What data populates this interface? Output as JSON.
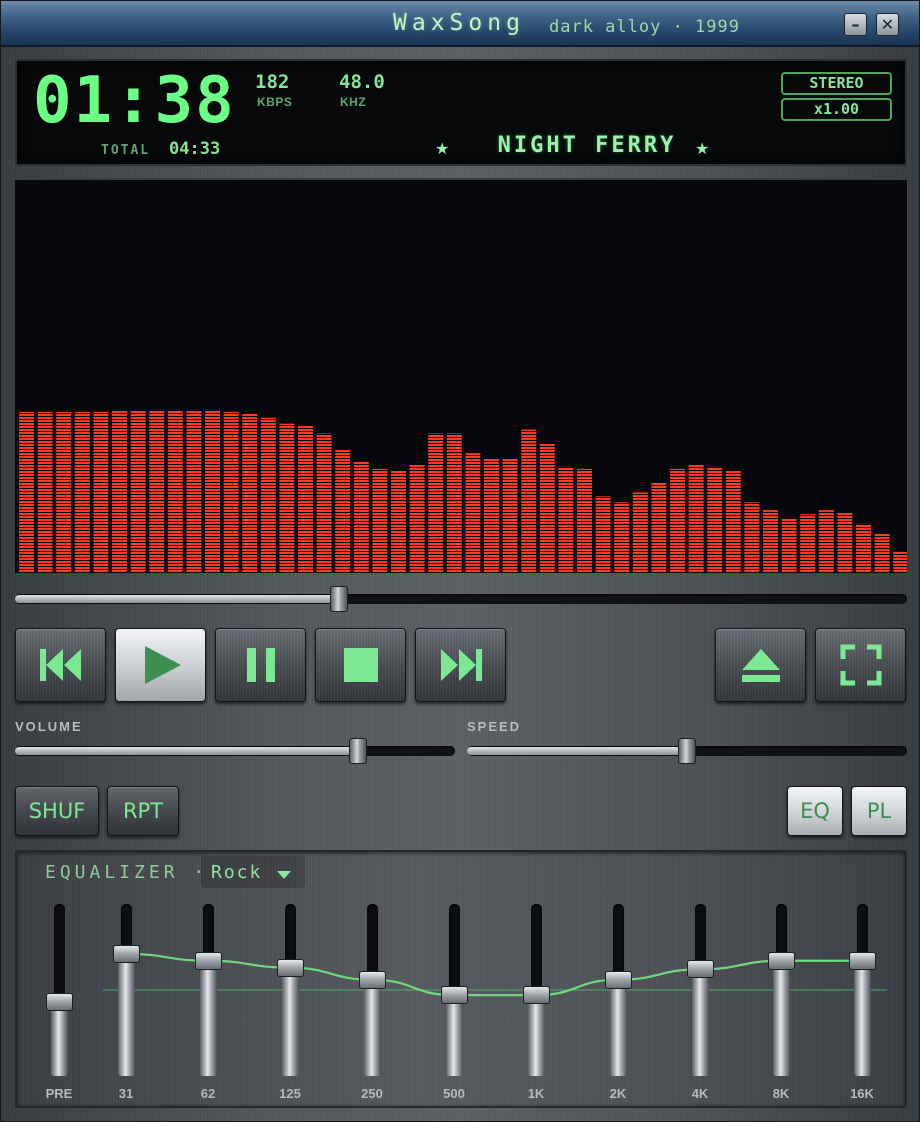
{
  "window": {
    "app_name": "WaxSong",
    "subtitle": "dark alloy · 1999",
    "minimize_glyph": "–",
    "close_glyph": "✕"
  },
  "display": {
    "time": "01:38",
    "bitrate": "182",
    "bitrate_unit": "KBPS",
    "samplerate": "48.0",
    "samplerate_unit": "KHZ",
    "total_label": "TOTAL",
    "total": "04:33",
    "channel_mode": "STEREO",
    "playback_rate": "x1.00",
    "track_title": "NIGHT FERRY",
    "star": "★"
  },
  "visualizer": {
    "levels": [
      0.41,
      0.41,
      0.41,
      0.41,
      0.41,
      0.415,
      0.415,
      0.415,
      0.415,
      0.415,
      0.415,
      0.41,
      0.405,
      0.395,
      0.38,
      0.375,
      0.355,
      0.315,
      0.285,
      0.265,
      0.26,
      0.275,
      0.355,
      0.355,
      0.305,
      0.29,
      0.29,
      0.365,
      0.33,
      0.27,
      0.265,
      0.195,
      0.18,
      0.205,
      0.23,
      0.265,
      0.275,
      0.27,
      0.26,
      0.18,
      0.16,
      0.14,
      0.15,
      0.16,
      0.155,
      0.125,
      0.1,
      0.055,
      0.025
    ],
    "colors": {
      "top": "#ff3a1f",
      "mid": "#f7b72a",
      "bottom": "#58c96a"
    }
  },
  "seek": {
    "position": 0.363
  },
  "transport": {
    "prev_icon": "skip-back-icon",
    "play_icon": "play-icon",
    "pause_icon": "pause-icon",
    "stop_icon": "stop-icon",
    "next_icon": "skip-forward-icon",
    "eject_icon": "eject-icon",
    "fullscreen_icon": "fullscreen-icon",
    "active": "play",
    "icon_color": "#7de893"
  },
  "volume": {
    "label": "VOLUME",
    "value": 0.78
  },
  "speed": {
    "label": "SPEED",
    "value": 0.5
  },
  "toggles": {
    "shuffle": "SHUF",
    "repeat": "RPT",
    "eq": "EQ",
    "playlist": "PL"
  },
  "equalizer": {
    "title": "EQUALIZER ·",
    "preset": "Rock",
    "bands": [
      {
        "label": "PRE",
        "level": 0.43
      },
      {
        "label": "31",
        "level": 0.71
      },
      {
        "label": "62",
        "level": 0.67
      },
      {
        "label": "125",
        "level": 0.63
      },
      {
        "label": "250",
        "level": 0.56
      },
      {
        "label": "500",
        "level": 0.47
      },
      {
        "label": "1K",
        "level": 0.47
      },
      {
        "label": "2K",
        "level": 0.56
      },
      {
        "label": "4K",
        "level": 0.62
      },
      {
        "label": "8K",
        "level": 0.67
      },
      {
        "label": "16K",
        "level": 0.67
      }
    ]
  }
}
